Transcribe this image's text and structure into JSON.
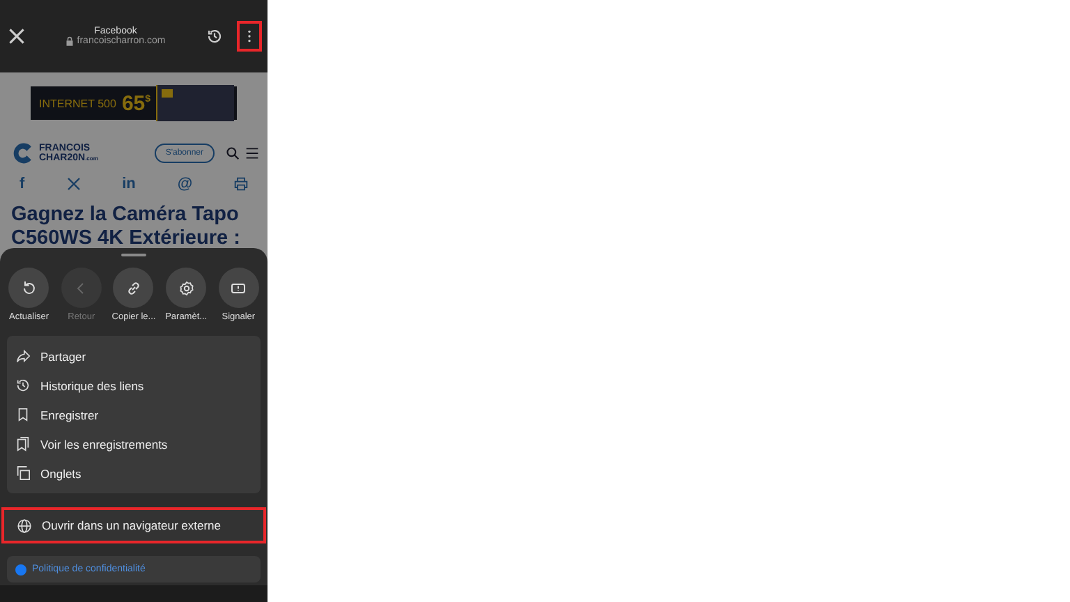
{
  "top_bar": {
    "title": "Facebook",
    "url": "francoischarron.com",
    "menu_highlighted": true
  },
  "page": {
    "ad": {
      "label": "INTERNET 500",
      "price": "65",
      "currency": "$"
    },
    "logo": {
      "line1": "FRANCOIS",
      "line2": "CHAR20N",
      "suffix": ".com"
    },
    "subscribe": "S'abonner",
    "social": [
      {
        "kind": "text",
        "glyph": "f"
      },
      {
        "kind": "x"
      },
      {
        "kind": "text",
        "glyph": "in"
      },
      {
        "kind": "text",
        "glyph": "@"
      },
      {
        "kind": "print"
      }
    ],
    "headline": "Gagnez la Caméra Tapo C560WS 4K Extérieure :"
  },
  "actions": [
    {
      "kind": "refresh",
      "label": "Actualiser",
      "disabled": false
    },
    {
      "kind": "back",
      "label": "Retour",
      "disabled": true
    },
    {
      "kind": "link",
      "label": "Copier le...",
      "disabled": false
    },
    {
      "kind": "gear",
      "label": "Paramèt...",
      "disabled": false
    },
    {
      "kind": "report",
      "label": "Signaler",
      "disabled": false
    }
  ],
  "menu": [
    {
      "kind": "share",
      "label": "Partager"
    },
    {
      "kind": "history",
      "label": "Historique des liens"
    },
    {
      "kind": "save",
      "label": "Enregistrer"
    },
    {
      "kind": "saved",
      "label": "Voir les enregistrements"
    },
    {
      "kind": "tabs",
      "label": "Onglets"
    }
  ],
  "external": {
    "label": "Ouvrir dans un navigateur externe",
    "highlighted": true
  },
  "privacy": {
    "label": "Politique de confidentialité"
  }
}
